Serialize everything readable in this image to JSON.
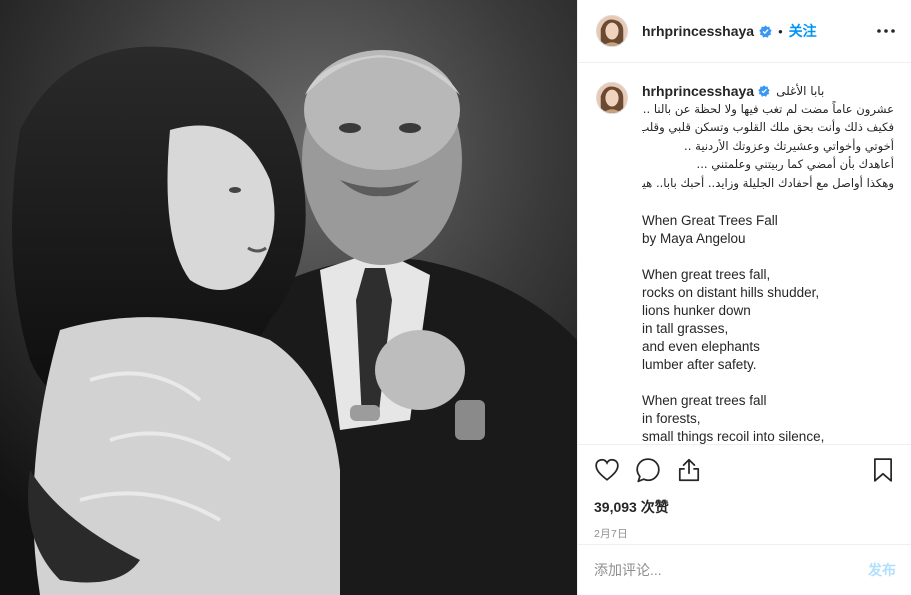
{
  "post": {
    "username": "hrhprincesshaya",
    "follow_label": "关注",
    "separator": "•",
    "likes": "39,093 次赞",
    "date": "2月7日"
  },
  "caption": {
    "username": "hrhprincesshaya",
    "first_line": "بابا الأغلى",
    "arabic_lines": [
      "عشرون عاماً مضت لم تغب فيها ولا لحظة عن بالنا ..",
      "فكيف ذلك وأنت بحق ملك القلوب وتسكن قلبي وقلب",
      "أخوتي وأخواتي وعشيرتك وعزوتك الأردنية ..",
      "أعاهدك بأن أمضي كما ربيتني وعلمتني ...",
      "وهكذا أواصل مع أحفادك الجليلة وزايد.. أحبك بابا.. هيا"
    ],
    "poem_stanzas": [
      [
        "When Great Trees Fall",
        "by Maya Angelou"
      ],
      [
        "When great trees fall,",
        "rocks on distant hills shudder,",
        "lions hunker down",
        "in tall grasses,",
        "and even elephants",
        "lumber after safety."
      ],
      [
        "When great trees fall",
        "in forests,",
        "small things recoil into silence,"
      ]
    ]
  },
  "comment": {
    "placeholder": "添加评论...",
    "post_label": "发布"
  },
  "icons": {
    "like": "heart-icon",
    "comment": "comment-icon",
    "share": "share-icon",
    "save": "bookmark-icon",
    "more": "more-icon",
    "verified": "verified-badge-icon"
  },
  "colors": {
    "accent": "#0095f6",
    "verified": "#3897f0",
    "muted": "#8e8e8e",
    "post_disabled": "#b2dffc"
  }
}
